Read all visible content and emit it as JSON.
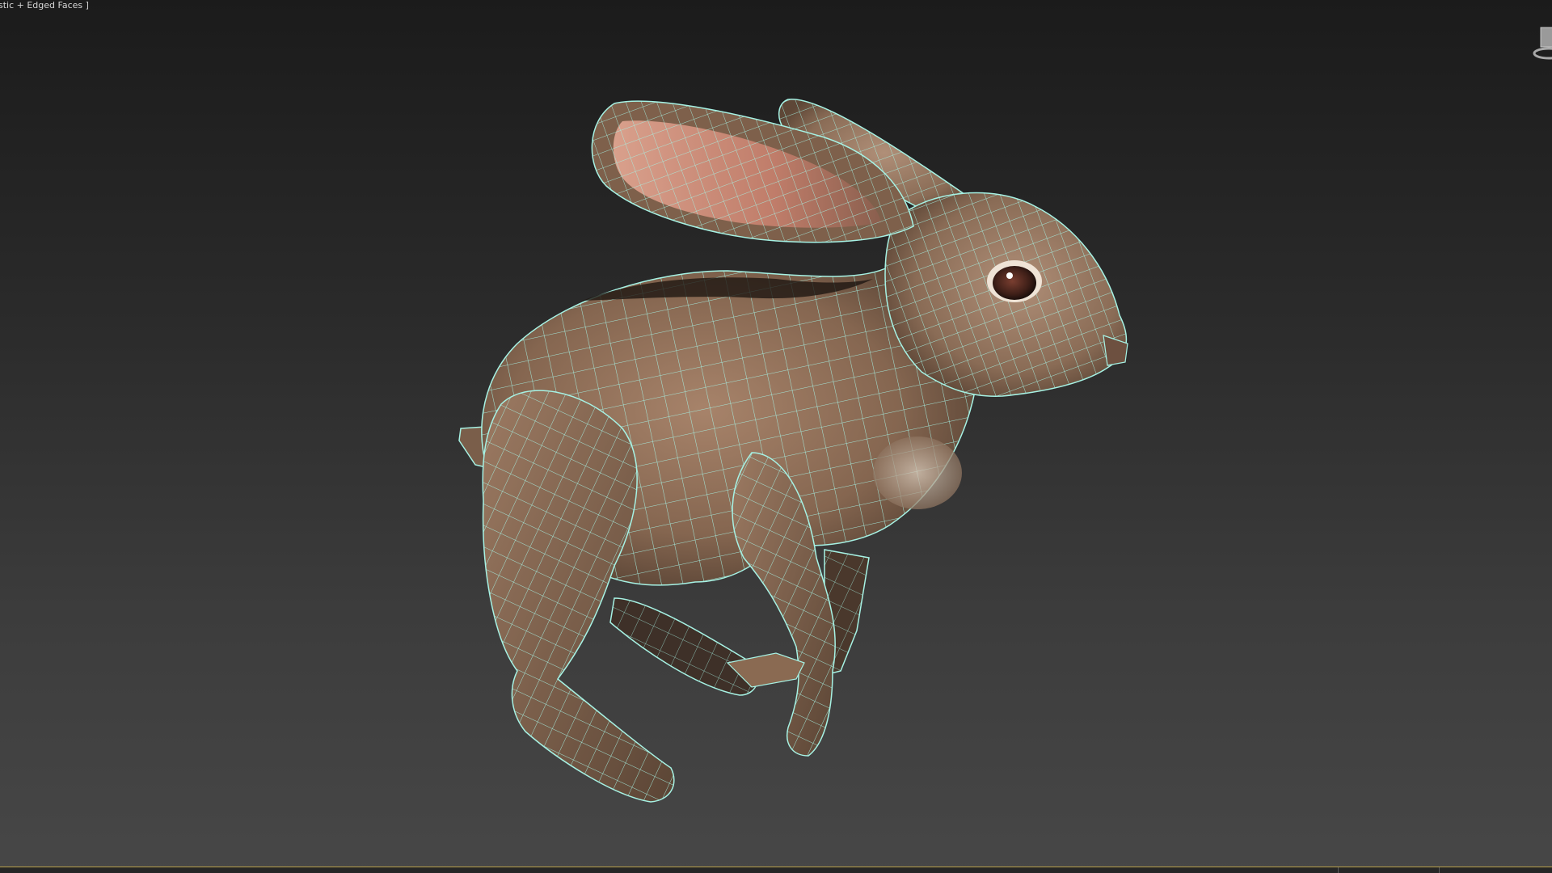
{
  "viewport": {
    "label": "stic + Edged Faces ]",
    "background_top": "#1b1b1b",
    "background_bottom": "#474747"
  },
  "model": {
    "object": "rabbit",
    "wire_color": "#9ef0e0",
    "fur_color": "#8a6a52",
    "inner_ear_color": "#c98a78"
  },
  "status_bar": {
    "accent_color": "#b8a04a"
  }
}
